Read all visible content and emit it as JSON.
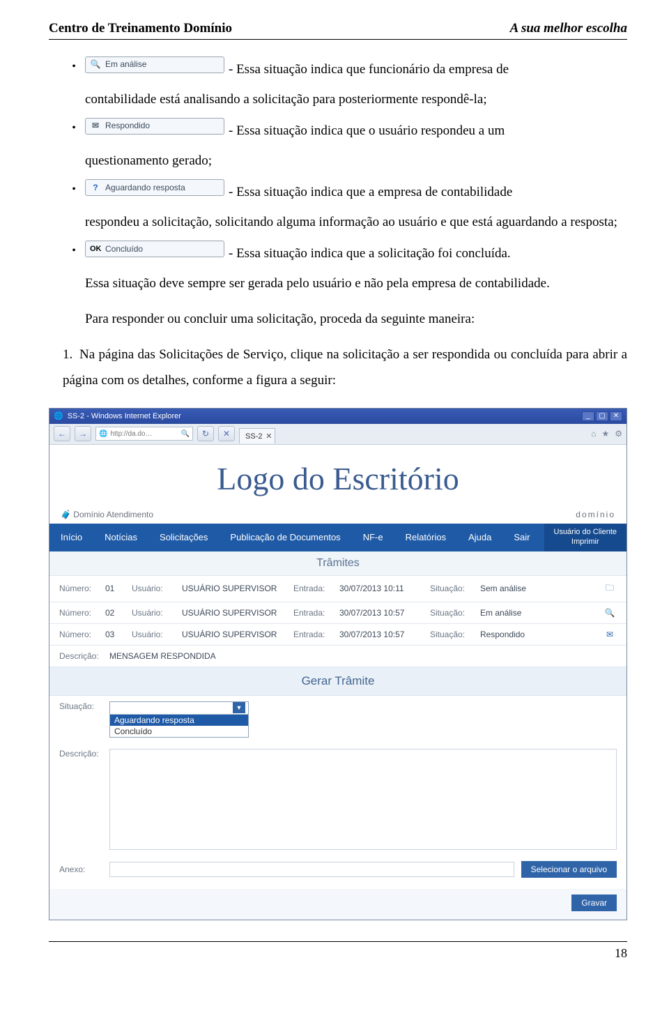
{
  "doc": {
    "header_left": "Centro de Treinamento Domínio",
    "header_right": "A sua melhor escolha",
    "page_number": "18"
  },
  "chips": {
    "em_analise": {
      "label": "Em análise",
      "icon": "🔍"
    },
    "respondido": {
      "label": "Respondido",
      "icon": "✉"
    },
    "aguardando": {
      "label": "Aguardando resposta",
      "icon": "?"
    },
    "concluido": {
      "label": "Concluído",
      "icon": "OK"
    }
  },
  "text": {
    "b1_after": " - Essa situação indica que funcionário da empresa de",
    "b1_cont": "contabilidade está analisando a solicitação para posteriormente respondê-la;",
    "b2_after": " - Essa situação indica que o usuário respondeu a um",
    "b2_cont": "questionamento gerado;",
    "b3_after": " - Essa situação indica que a empresa de contabilidade",
    "b3_cont": "respondeu a solicitação, solicitando alguma informação ao usuário e que está aguardando a resposta;",
    "b4_after": " - Essa situação indica que a solicitação foi concluída.",
    "b4_cont": "Essa situação deve sempre ser gerada pelo usuário e não pela empresa de contabilidade.",
    "para1": "Para responder ou concluir uma solicitação, proceda da seguinte maneira:",
    "num1": "Na página das Solicitações de Serviço, clique na solicitação a ser respondida ou concluída para abrir a página com os detalhes, conforme a figura a seguir:"
  },
  "screenshot": {
    "window_title": "SS-2 - Windows Internet Explorer",
    "url_text": "http://da.do…",
    "tab_label": "SS-2",
    "logo_text": "Logo do Escritório",
    "brand_left": "Domínio Atendimento",
    "brand_right": "domínio",
    "nav": [
      "Início",
      "Notícias",
      "Solicitações",
      "Publicação de Documentos",
      "NF-e",
      "Relatórios",
      "Ajuda",
      "Sair"
    ],
    "nav_right_top": "Usuário do Cliente",
    "nav_right_bottom": "Imprimir",
    "tramites_title": "Trâmites",
    "labels": {
      "numero": "Número:",
      "usuario": "Usuário:",
      "entrada": "Entrada:",
      "situacao": "Situação:",
      "descricao": "Descrição:",
      "anexo": "Anexo:"
    },
    "rows": [
      {
        "num": "01",
        "user": "USUÁRIO SUPERVISOR",
        "date": "30/07/2013 10:11",
        "sit": "Sem análise",
        "icon": "folder"
      },
      {
        "num": "02",
        "user": "USUÁRIO SUPERVISOR",
        "date": "30/07/2013 10:57",
        "sit": "Em análise",
        "icon": "search"
      },
      {
        "num": "03",
        "user": "USUÁRIO SUPERVISOR",
        "date": "30/07/2013 10:57",
        "sit": "Respondido",
        "icon": "mail"
      }
    ],
    "descricao_value": "MENSAGEM RESPONDIDA",
    "gerar_title": "Gerar Trâmite",
    "dropdown": {
      "options": [
        "Aguardando resposta",
        "Concluído"
      ],
      "selected_index": 0
    },
    "btn_select_file": "Selecionar o arquivo",
    "btn_save": "Gravar"
  }
}
